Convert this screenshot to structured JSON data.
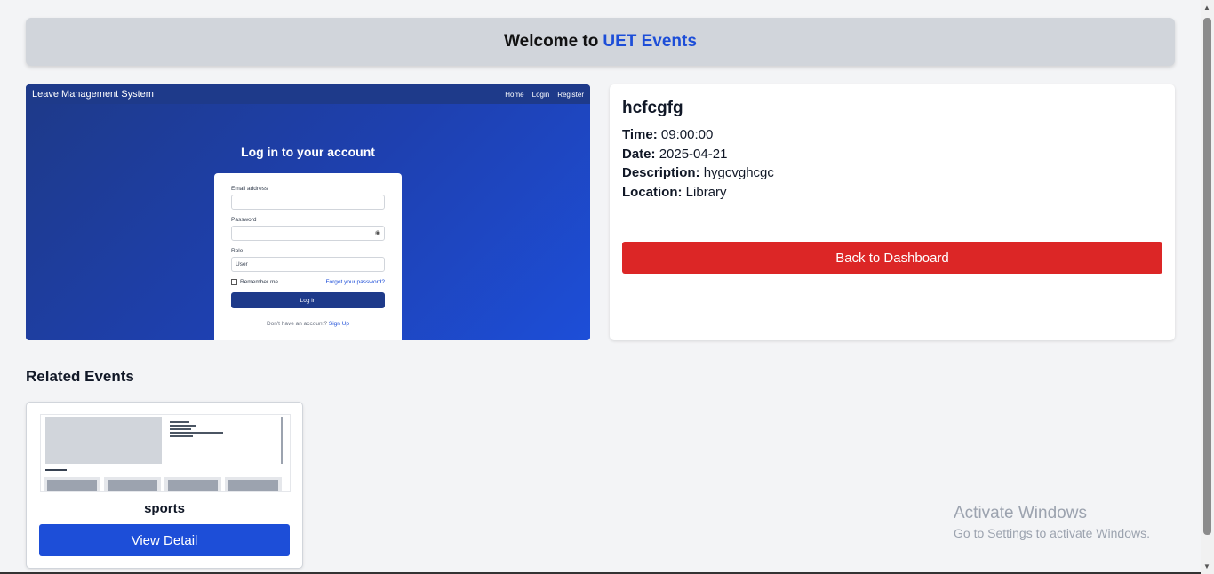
{
  "header": {
    "prefix": "Welcome to",
    "brand": "UET Events"
  },
  "event_image": {
    "nav_title": "Leave Management System",
    "nav_links": [
      "Home",
      "Login",
      "Register"
    ],
    "form_title": "Log in to your account",
    "email_label": "Email address",
    "password_label": "Password",
    "role_label": "Role",
    "role_value": "User",
    "remember_label": "Remember me",
    "forgot_label": "Forgot your password?",
    "login_button": "Log in",
    "signup_prompt": "Don't have an account?",
    "signup_link": "Sign Up"
  },
  "event": {
    "title": "hcfcgfg",
    "time_label": "Time:",
    "time": "09:00:00",
    "date_label": "Date:",
    "date": "2025-04-21",
    "description_label": "Description:",
    "description": "hygcvghcgc",
    "location_label": "Location:",
    "location": "Library",
    "back_button": "Back to Dashboard"
  },
  "related": {
    "heading": "Related Events",
    "items": [
      {
        "name": "sports",
        "button": "View Detail"
      }
    ]
  },
  "watermark": {
    "title": "Activate Windows",
    "subtitle": "Go to Settings to activate Windows."
  },
  "colors": {
    "brand_blue": "#1d4ed8",
    "danger_red": "#dc2626",
    "header_gray": "#d1d5db",
    "background": "#f3f4f6"
  }
}
